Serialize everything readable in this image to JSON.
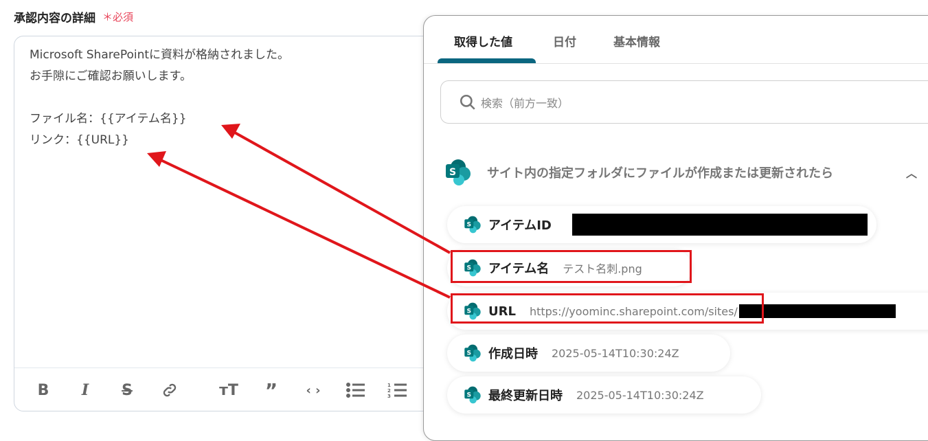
{
  "field": {
    "label": "承認内容の詳細",
    "required": "＊必須"
  },
  "editor": {
    "text": "Microsoft SharePointに資料が格納されました。\nお手隙にご確認お願いします。\n\nファイル名：{{アイテム名}}\nリンク：{{URL}}",
    "toolbar": [
      "bold-icon",
      "italic-icon",
      "strikethrough-icon",
      "link-icon",
      "text-size-icon",
      "quote-icon",
      "code-icon",
      "bullet-list-icon",
      "numbered-list-icon"
    ]
  },
  "panel": {
    "tabs": [
      {
        "label": "取得した値",
        "active": true
      },
      {
        "label": "日付"
      },
      {
        "label": "基本情報"
      }
    ],
    "search_placeholder": "検索（前方一致）",
    "section_title": "サイト内の指定フォルダにファイルが作成または更新されたら",
    "items": [
      {
        "key": "アイテムID",
        "value": ""
      },
      {
        "key": "アイテム名",
        "value": "テスト名刺.png"
      },
      {
        "key": "URL",
        "value": "https://yoominc.sharepoint.com/sites/"
      },
      {
        "key": "作成日時",
        "value": "2025-05-14T10:30:24Z"
      },
      {
        "key": "最終更新日時",
        "value": "2025-05-14T10:30:24Z"
      }
    ]
  },
  "colors": {
    "accent": "#0b6680",
    "annotation": "#e0161b",
    "required": "#e8455a"
  }
}
